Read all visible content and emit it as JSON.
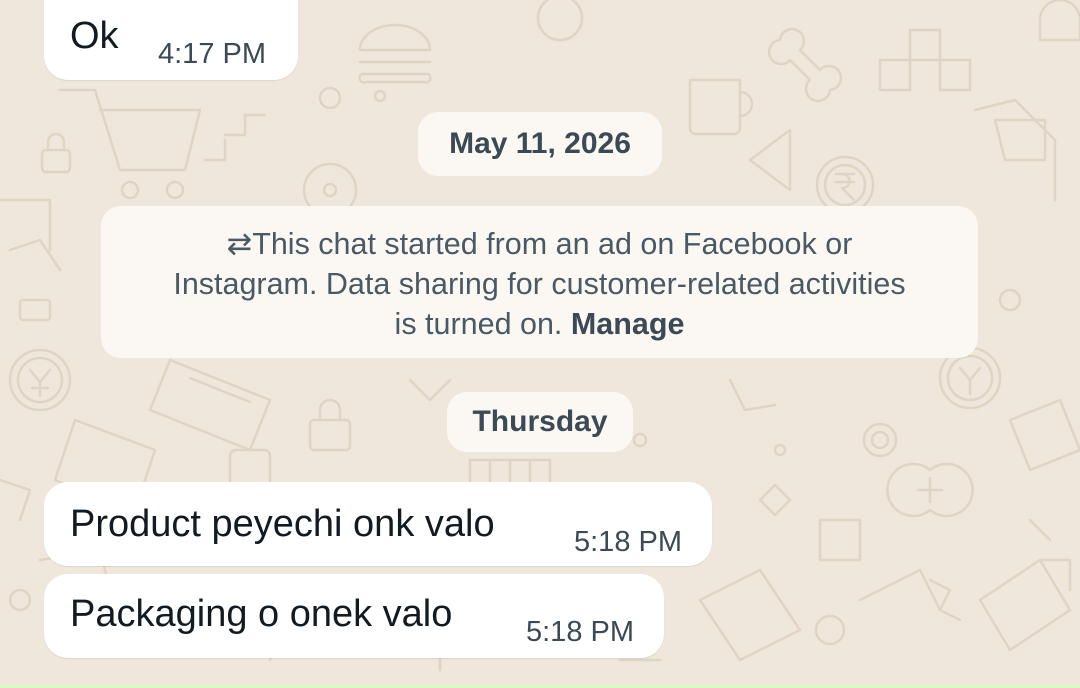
{
  "messages": [
    {
      "text": "Ok",
      "time": "4:17 PM"
    },
    {
      "text": "Product peyechi onk valo",
      "time": "5:18 PM"
    },
    {
      "text": "Packaging o onek valo",
      "time": "5:18 PM"
    }
  ],
  "date_dividers": {
    "first": "May 11, 2026",
    "second": "Thursday"
  },
  "ad_notice": {
    "icon": "⇄",
    "line1": "This chat started from an ad on Facebook or",
    "line2": "Instagram. Data sharing for customer-related activities",
    "line3_prefix": "is turned on.",
    "manage_label": "Manage"
  },
  "colors": {
    "wallpaper": "#efe7dc",
    "incoming_bubble": "#ffffff",
    "system_pill": "#fbf8f3",
    "text_primary": "#111b21",
    "text_secondary": "#3b4a54"
  }
}
